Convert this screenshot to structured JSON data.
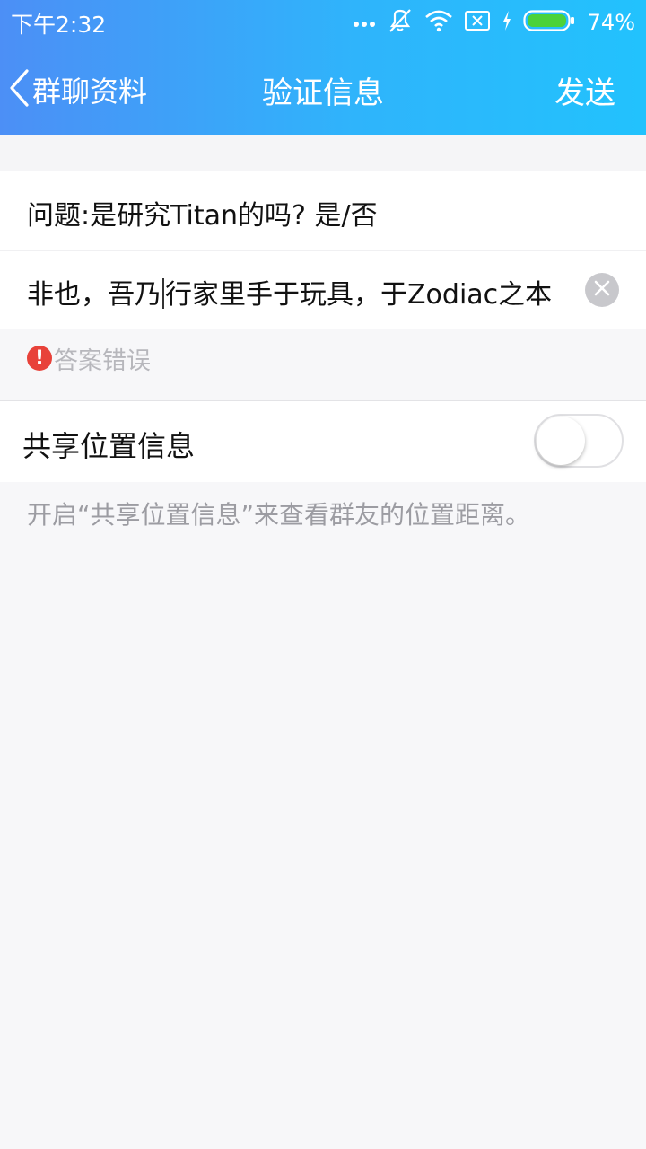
{
  "status_bar": {
    "time": "下午2:32",
    "battery_percent": "74%",
    "battery_level": 0.74,
    "icons": [
      "more-dots-icon",
      "vibrate-off-icon",
      "wifi-icon",
      "sim-error-icon",
      "charging-icon",
      "battery-icon"
    ]
  },
  "nav": {
    "back_label": "群聊资料",
    "title": "验证信息",
    "send_label": "发送"
  },
  "form": {
    "question": "问题:是研究Titan的吗? 是/否",
    "answer_before_caret": "非也，吾乃",
    "answer_after_caret": "行家里手于玩具，于Zodiac之本",
    "error_text": "答案错误",
    "error_icon_glyph": "!"
  },
  "share": {
    "label": "共享位置信息",
    "enabled": false,
    "hint": "开启“共享位置信息”来查看群友的位置距离。"
  },
  "colors": {
    "header_start": "#4c8ff6",
    "header_end": "#22c2fd",
    "error_red": "#e8423a"
  }
}
